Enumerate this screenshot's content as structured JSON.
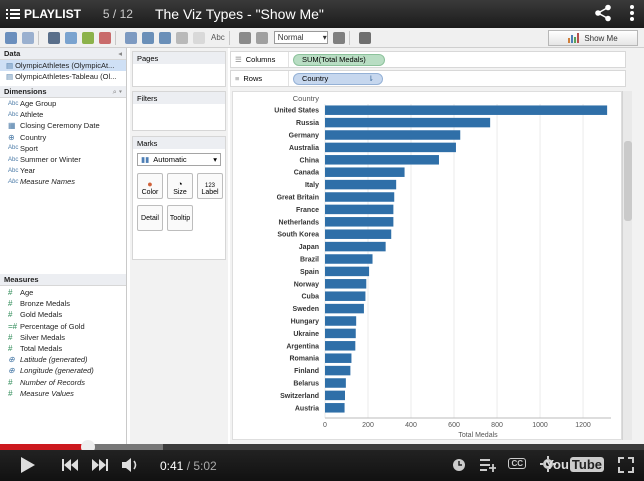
{
  "youtube": {
    "playlist_label": "PLAYLIST",
    "playlist_count": "5 / 12",
    "video_title": "The Viz Types - \"Show Me\"",
    "current_time": "0:41",
    "duration": "/ 5:02",
    "logo_you": "You",
    "logo_tube": "Tube",
    "cc_label": "CC",
    "progress_fraction": 0.136
  },
  "toolbar": {
    "abc_label": "Abc",
    "fit_select": "Normal",
    "show_me_label": "Show Me"
  },
  "data_pane": {
    "title": "Data",
    "sources": [
      {
        "label": "OlympicAthletes (OlympicAt...",
        "selected": true
      },
      {
        "label": "OlympicAthletes-Tableau (Ol...",
        "selected": false
      }
    ],
    "dimensions_title": "Dimensions",
    "dimensions": [
      {
        "icon": "Abc",
        "label": "Age Group",
        "italic": false
      },
      {
        "icon": "Abc",
        "label": "Athlete",
        "italic": false
      },
      {
        "icon": "cal",
        "label": "Closing Ceremony Date",
        "italic": false
      },
      {
        "icon": "globe",
        "label": "Country",
        "italic": false
      },
      {
        "icon": "Abc",
        "label": "Sport",
        "italic": false
      },
      {
        "icon": "Abc",
        "label": "Summer or Winter",
        "italic": false
      },
      {
        "icon": "Abc",
        "label": "Year",
        "italic": false
      },
      {
        "icon": "Abc",
        "label": "Measure Names",
        "italic": true
      }
    ],
    "measures_title": "Measures",
    "measures": [
      {
        "icon": "#",
        "label": "Age",
        "italic": false
      },
      {
        "icon": "#",
        "label": "Bronze Medals",
        "italic": false
      },
      {
        "icon": "#",
        "label": "Gold Medals",
        "italic": false
      },
      {
        "icon": "=#",
        "label": "Percentage of Gold",
        "italic": false
      },
      {
        "icon": "#",
        "label": "Silver Medals",
        "italic": false
      },
      {
        "icon": "#",
        "label": "Total Medals",
        "italic": false
      },
      {
        "icon": "globe",
        "label": "Latitude (generated)",
        "italic": true
      },
      {
        "icon": "globe",
        "label": "Longitude (generated)",
        "italic": true
      },
      {
        "icon": "#",
        "label": "Number of Records",
        "italic": true
      },
      {
        "icon": "#",
        "label": "Measure Values",
        "italic": true
      }
    ]
  },
  "shelves": {
    "pages_title": "Pages",
    "filters_title": "Filters",
    "marks_title": "Marks",
    "marks_type": "Automatic",
    "color_label": "Color",
    "size_label": "Size",
    "label_label": "Label",
    "label_icon_text": "123",
    "detail_label": "Detail",
    "tooltip_label": "Tooltip",
    "columns_label": "Columns",
    "columns_pill": "SUM(Total Medals)",
    "rows_label": "Rows",
    "rows_pill": "Country"
  },
  "chart_data": {
    "type": "bar",
    "orientation": "horizontal",
    "header_label": "Country",
    "xlabel": "Total Medals",
    "xlim": [
      0,
      1330
    ],
    "xticks": [
      0,
      200,
      400,
      600,
      800,
      1000,
      1200
    ],
    "categories": [
      "United States",
      "Russia",
      "Germany",
      "Australia",
      "China",
      "Canada",
      "Italy",
      "Great Britain",
      "France",
      "Netherlands",
      "South Korea",
      "Japan",
      "Brazil",
      "Spain",
      "Norway",
      "Cuba",
      "Sweden",
      "Hungary",
      "Ukraine",
      "Argentina",
      "Romania",
      "Finland",
      "Belarus",
      "Switzerland",
      "Austria"
    ],
    "values": [
      1312,
      768,
      629,
      609,
      530,
      370,
      331,
      322,
      318,
      318,
      308,
      282,
      221,
      205,
      192,
      188,
      181,
      145,
      143,
      141,
      123,
      118,
      97,
      93,
      91
    ],
    "bar_color": "#2f6fa8",
    "grid": "vertical"
  }
}
